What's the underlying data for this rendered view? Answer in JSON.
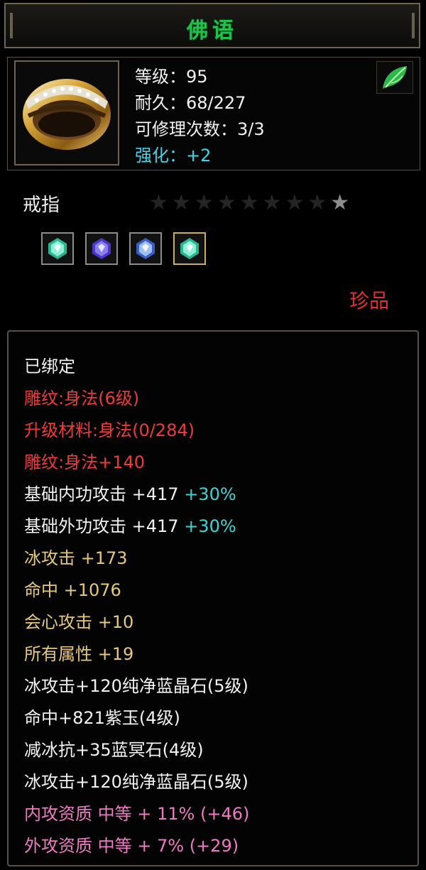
{
  "item": {
    "name": "佛语",
    "type": "戒指",
    "rarity": "珍品",
    "stars_total": 9,
    "stars_lit": 1,
    "title_color": "#20c24a",
    "icon": "gold-ring-icon"
  },
  "stats": {
    "level": "等级：95",
    "durability": "耐久：68/227",
    "repair_count": "可修理次数：3/3",
    "enhance": "强化：+2"
  },
  "gems": [
    {
      "icon": "green-gem-icon"
    },
    {
      "icon": "purple-gem-icon"
    },
    {
      "icon": "blue-gem-icon"
    },
    {
      "icon": "green-gem-icon"
    }
  ],
  "attributes": {
    "bound": "已绑定",
    "engrave": "雕纹:身法(6级)",
    "upgrade_material": "升级材料:身法(0/284)",
    "engrave_bonus": "雕纹:身法+140",
    "inner_attack": {
      "label": "基础内功攻击  +417",
      "bonus": "+30%"
    },
    "outer_attack": {
      "label": "基础外功攻击  +417",
      "bonus": "+30%"
    },
    "ice_attack": "冰攻击  +173",
    "hit": "命中  +1076",
    "crit": "会心攻击  +10",
    "all_attr": "所有属性  +19",
    "socket1": "冰攻击+120纯净蓝晶石(5级)",
    "socket2": "命中+821紫玉(4级)",
    "socket3": "减冰抗+35蓝冥石(4级)",
    "socket4": "冰攻击+120纯净蓝晶石(5级)",
    "inner_quality": "内攻资质  中等  + 11% (+46)",
    "outer_quality": "外攻资质  中等  + 7% (+29)"
  }
}
